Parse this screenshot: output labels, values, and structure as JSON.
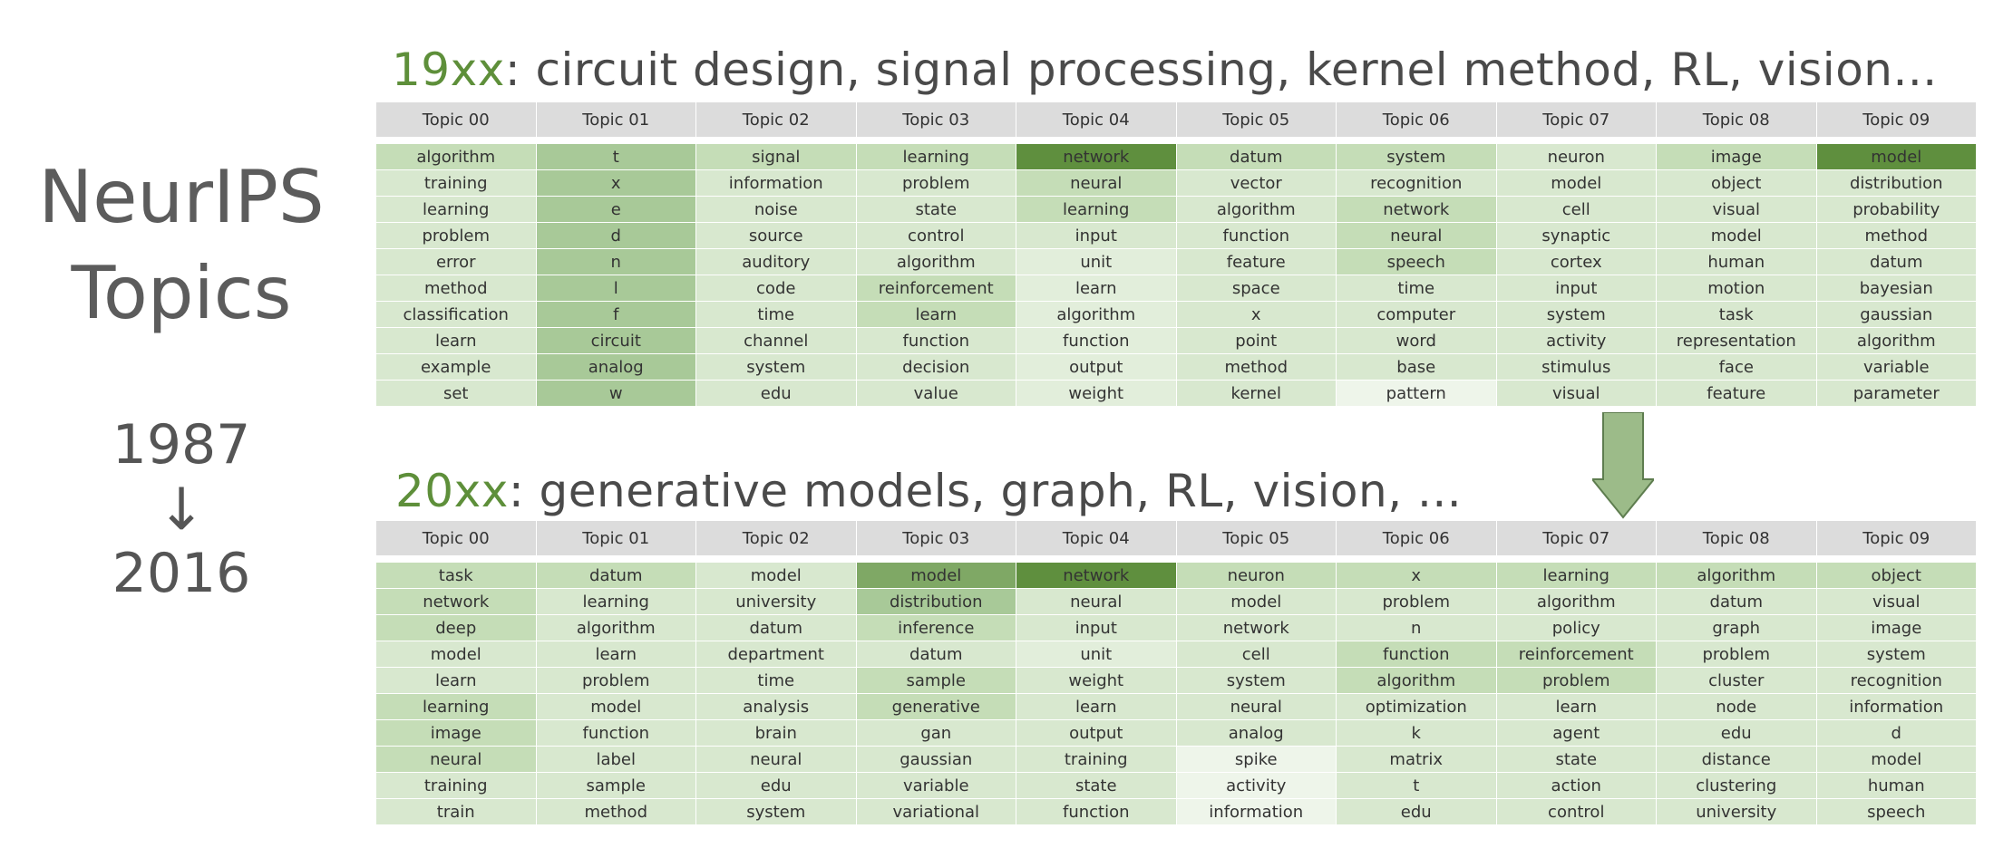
{
  "side": {
    "title_line1": "NeurIPS",
    "title_line2": "Topics",
    "year_start": "1987",
    "year_arrow": "↓",
    "year_end": "2016"
  },
  "panel1": {
    "era": "19xx",
    "description": ": circuit design, signal processing, kernel method, RL, vision...",
    "headers": [
      "Topic 00",
      "Topic 01",
      "Topic 02",
      "Topic 03",
      "Topic 04",
      "Topic 05",
      "Topic 06",
      "Topic 07",
      "Topic 08",
      "Topic 09"
    ],
    "rows": [
      [
        "algorithm",
        "t",
        "signal",
        "learning",
        "network",
        "datum",
        "system",
        "neuron",
        "image",
        "model"
      ],
      [
        "training",
        "x",
        "information",
        "problem",
        "neural",
        "vector",
        "recognition",
        "model",
        "object",
        "distribution"
      ],
      [
        "learning",
        "e",
        "noise",
        "state",
        "learning",
        "algorithm",
        "network",
        "cell",
        "visual",
        "probability"
      ],
      [
        "problem",
        "d",
        "source",
        "control",
        "input",
        "function",
        "neural",
        "synaptic",
        "model",
        "method"
      ],
      [
        "error",
        "n",
        "auditory",
        "algorithm",
        "unit",
        "feature",
        "speech",
        "cortex",
        "human",
        "datum"
      ],
      [
        "method",
        "l",
        "code",
        "reinforcement",
        "learn",
        "space",
        "time",
        "input",
        "motion",
        "bayesian"
      ],
      [
        "classification",
        "f",
        "time",
        "learn",
        "algorithm",
        "x",
        "computer",
        "system",
        "task",
        "gaussian"
      ],
      [
        "learn",
        "circuit",
        "channel",
        "function",
        "function",
        "point",
        "word",
        "activity",
        "representation",
        "algorithm"
      ],
      [
        "example",
        "analog",
        "system",
        "decision",
        "output",
        "method",
        "base",
        "stimulus",
        "face",
        "variable"
      ],
      [
        "set",
        "w",
        "edu",
        "value",
        "weight",
        "kernel",
        "pattern",
        "visual",
        "feature",
        "parameter"
      ]
    ],
    "shades": [
      [
        2,
        3,
        2,
        2,
        5,
        2,
        2,
        1,
        2,
        5
      ],
      [
        1,
        3,
        1,
        1,
        2,
        1,
        1,
        1,
        1,
        1
      ],
      [
        1,
        3,
        1,
        1,
        2,
        1,
        2,
        1,
        1,
        1
      ],
      [
        1,
        3,
        1,
        1,
        1,
        1,
        2,
        1,
        1,
        1
      ],
      [
        1,
        3,
        1,
        1,
        0,
        1,
        2,
        1,
        1,
        1
      ],
      [
        1,
        3,
        1,
        2,
        0,
        1,
        1,
        1,
        1,
        1
      ],
      [
        1,
        3,
        1,
        2,
        0,
        1,
        1,
        1,
        1,
        1
      ],
      [
        1,
        3,
        1,
        1,
        0,
        1,
        1,
        1,
        1,
        1
      ],
      [
        1,
        3,
        1,
        1,
        0,
        1,
        1,
        1,
        1,
        1
      ],
      [
        1,
        3,
        1,
        1,
        0,
        1,
        -1,
        1,
        1,
        1
      ]
    ]
  },
  "panel2": {
    "era": "20xx",
    "description": ": generative models, graph, RL, vision, ...",
    "headers": [
      "Topic 00",
      "Topic 01",
      "Topic 02",
      "Topic 03",
      "Topic 04",
      "Topic 05",
      "Topic 06",
      "Topic 07",
      "Topic 08",
      "Topic 09"
    ],
    "rows": [
      [
        "task",
        "datum",
        "model",
        "model",
        "network",
        "neuron",
        "x",
        "learning",
        "algorithm",
        "object"
      ],
      [
        "network",
        "learning",
        "university",
        "distribution",
        "neural",
        "model",
        "problem",
        "algorithm",
        "datum",
        "visual"
      ],
      [
        "deep",
        "algorithm",
        "datum",
        "inference",
        "input",
        "network",
        "n",
        "policy",
        "graph",
        "image"
      ],
      [
        "model",
        "learn",
        "department",
        "datum",
        "unit",
        "cell",
        "function",
        "reinforcement",
        "problem",
        "system"
      ],
      [
        "learn",
        "problem",
        "time",
        "sample",
        "weight",
        "system",
        "algorithm",
        "problem",
        "cluster",
        "recognition"
      ],
      [
        "learning",
        "model",
        "analysis",
        "generative",
        "learn",
        "neural",
        "optimization",
        "learn",
        "node",
        "information"
      ],
      [
        "image",
        "function",
        "brain",
        "gan",
        "output",
        "analog",
        "k",
        "agent",
        "edu",
        "d"
      ],
      [
        "neural",
        "label",
        "neural",
        "gaussian",
        "training",
        "spike",
        "matrix",
        "state",
        "distance",
        "model"
      ],
      [
        "training",
        "sample",
        "edu",
        "variable",
        "state",
        "activity",
        "t",
        "action",
        "clustering",
        "human"
      ],
      [
        "train",
        "method",
        "system",
        "variational",
        "function",
        "information",
        "edu",
        "control",
        "university",
        "speech"
      ]
    ],
    "shades": [
      [
        2,
        2,
        1,
        4,
        5,
        2,
        2,
        2,
        2,
        2
      ],
      [
        2,
        1,
        1,
        3,
        1,
        1,
        1,
        1,
        1,
        1
      ],
      [
        2,
        1,
        1,
        2,
        1,
        1,
        1,
        1,
        1,
        1
      ],
      [
        1,
        1,
        1,
        1,
        0,
        1,
        2,
        2,
        1,
        1
      ],
      [
        1,
        1,
        1,
        2,
        1,
        1,
        2,
        2,
        1,
        1
      ],
      [
        2,
        1,
        1,
        2,
        1,
        1,
        1,
        1,
        1,
        1
      ],
      [
        2,
        1,
        1,
        1,
        1,
        1,
        1,
        1,
        1,
        1
      ],
      [
        2,
        1,
        1,
        1,
        1,
        -1,
        1,
        1,
        1,
        1
      ],
      [
        1,
        1,
        1,
        1,
        1,
        -1,
        1,
        1,
        1,
        1
      ],
      [
        1,
        1,
        1,
        1,
        1,
        -1,
        1,
        1,
        1,
        1
      ]
    ]
  },
  "colors": {
    "level_-1": "#eef5ea",
    "level_0": "#e2eedb",
    "level_1": "#d8e8cf",
    "level_2": "#c5ddb7",
    "level_3": "#a8c998",
    "level_4": "#7fa865",
    "level_5": "#5f8f3e",
    "header": "#dcdcdc",
    "era": "#5e8f3a",
    "arrow_fill": "#9cbb89",
    "arrow_stroke": "#5e7d4f"
  }
}
